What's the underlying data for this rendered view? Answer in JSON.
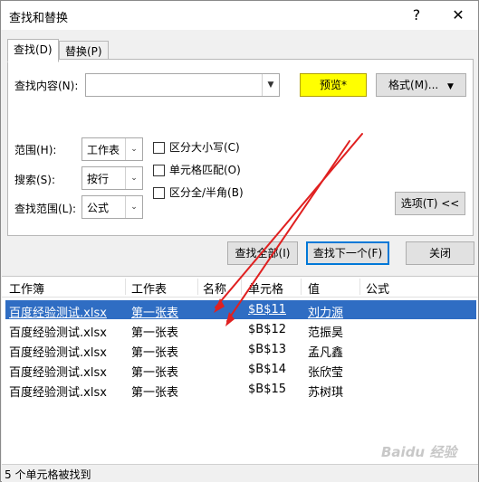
{
  "window": {
    "title": "查找和替换",
    "help_label": "?",
    "close_label": "✕"
  },
  "tabs": [
    {
      "label": "查找(D)"
    },
    {
      "label": "替换(P)"
    }
  ],
  "find": {
    "label": "查找内容(N):",
    "value": "",
    "preview_label": "预览*",
    "format_label": "格式(M)..."
  },
  "options": {
    "scope": {
      "label": "范围(H):",
      "value": "工作表"
    },
    "search": {
      "label": "搜索(S):",
      "value": "按行"
    },
    "lookin": {
      "label": "查找范围(L):",
      "value": "公式"
    },
    "match_case": "区分大小写(C)",
    "match_cell": "单元格匹配(O)",
    "match_width": "区分全/半角(B)",
    "options_button": "选项(T) <<"
  },
  "actions": {
    "find_all": "查找全部(I)",
    "find_next": "查找下一个(F)",
    "close": "关闭"
  },
  "colors": {
    "preview_bg": "#ffff00",
    "selection_bg": "#2f6dc3",
    "arrow": "#e02020"
  },
  "results": {
    "columns": [
      "工作簿",
      "工作表",
      "名称",
      "单元格",
      "值",
      "公式"
    ],
    "rows": [
      {
        "book": "百度经验测试.xlsx",
        "sheet": "第一张表",
        "name": "",
        "cell": "$B$11",
        "value": "刘力源",
        "formula": ""
      },
      {
        "book": "百度经验测试.xlsx",
        "sheet": "第一张表",
        "name": "",
        "cell": "$B$12",
        "value": "范振昊",
        "formula": ""
      },
      {
        "book": "百度经验测试.xlsx",
        "sheet": "第一张表",
        "name": "",
        "cell": "$B$13",
        "value": "孟凡鑫",
        "formula": ""
      },
      {
        "book": "百度经验测试.xlsx",
        "sheet": "第一张表",
        "name": "",
        "cell": "$B$14",
        "value": "张欣莹",
        "formula": ""
      },
      {
        "book": "百度经验测试.xlsx",
        "sheet": "第一张表",
        "name": "",
        "cell": "$B$15",
        "value": "苏树琪",
        "formula": ""
      }
    ],
    "selected_index": 0
  },
  "status": {
    "text": "5 个单元格被找到"
  },
  "watermark": "Baidu 经验"
}
